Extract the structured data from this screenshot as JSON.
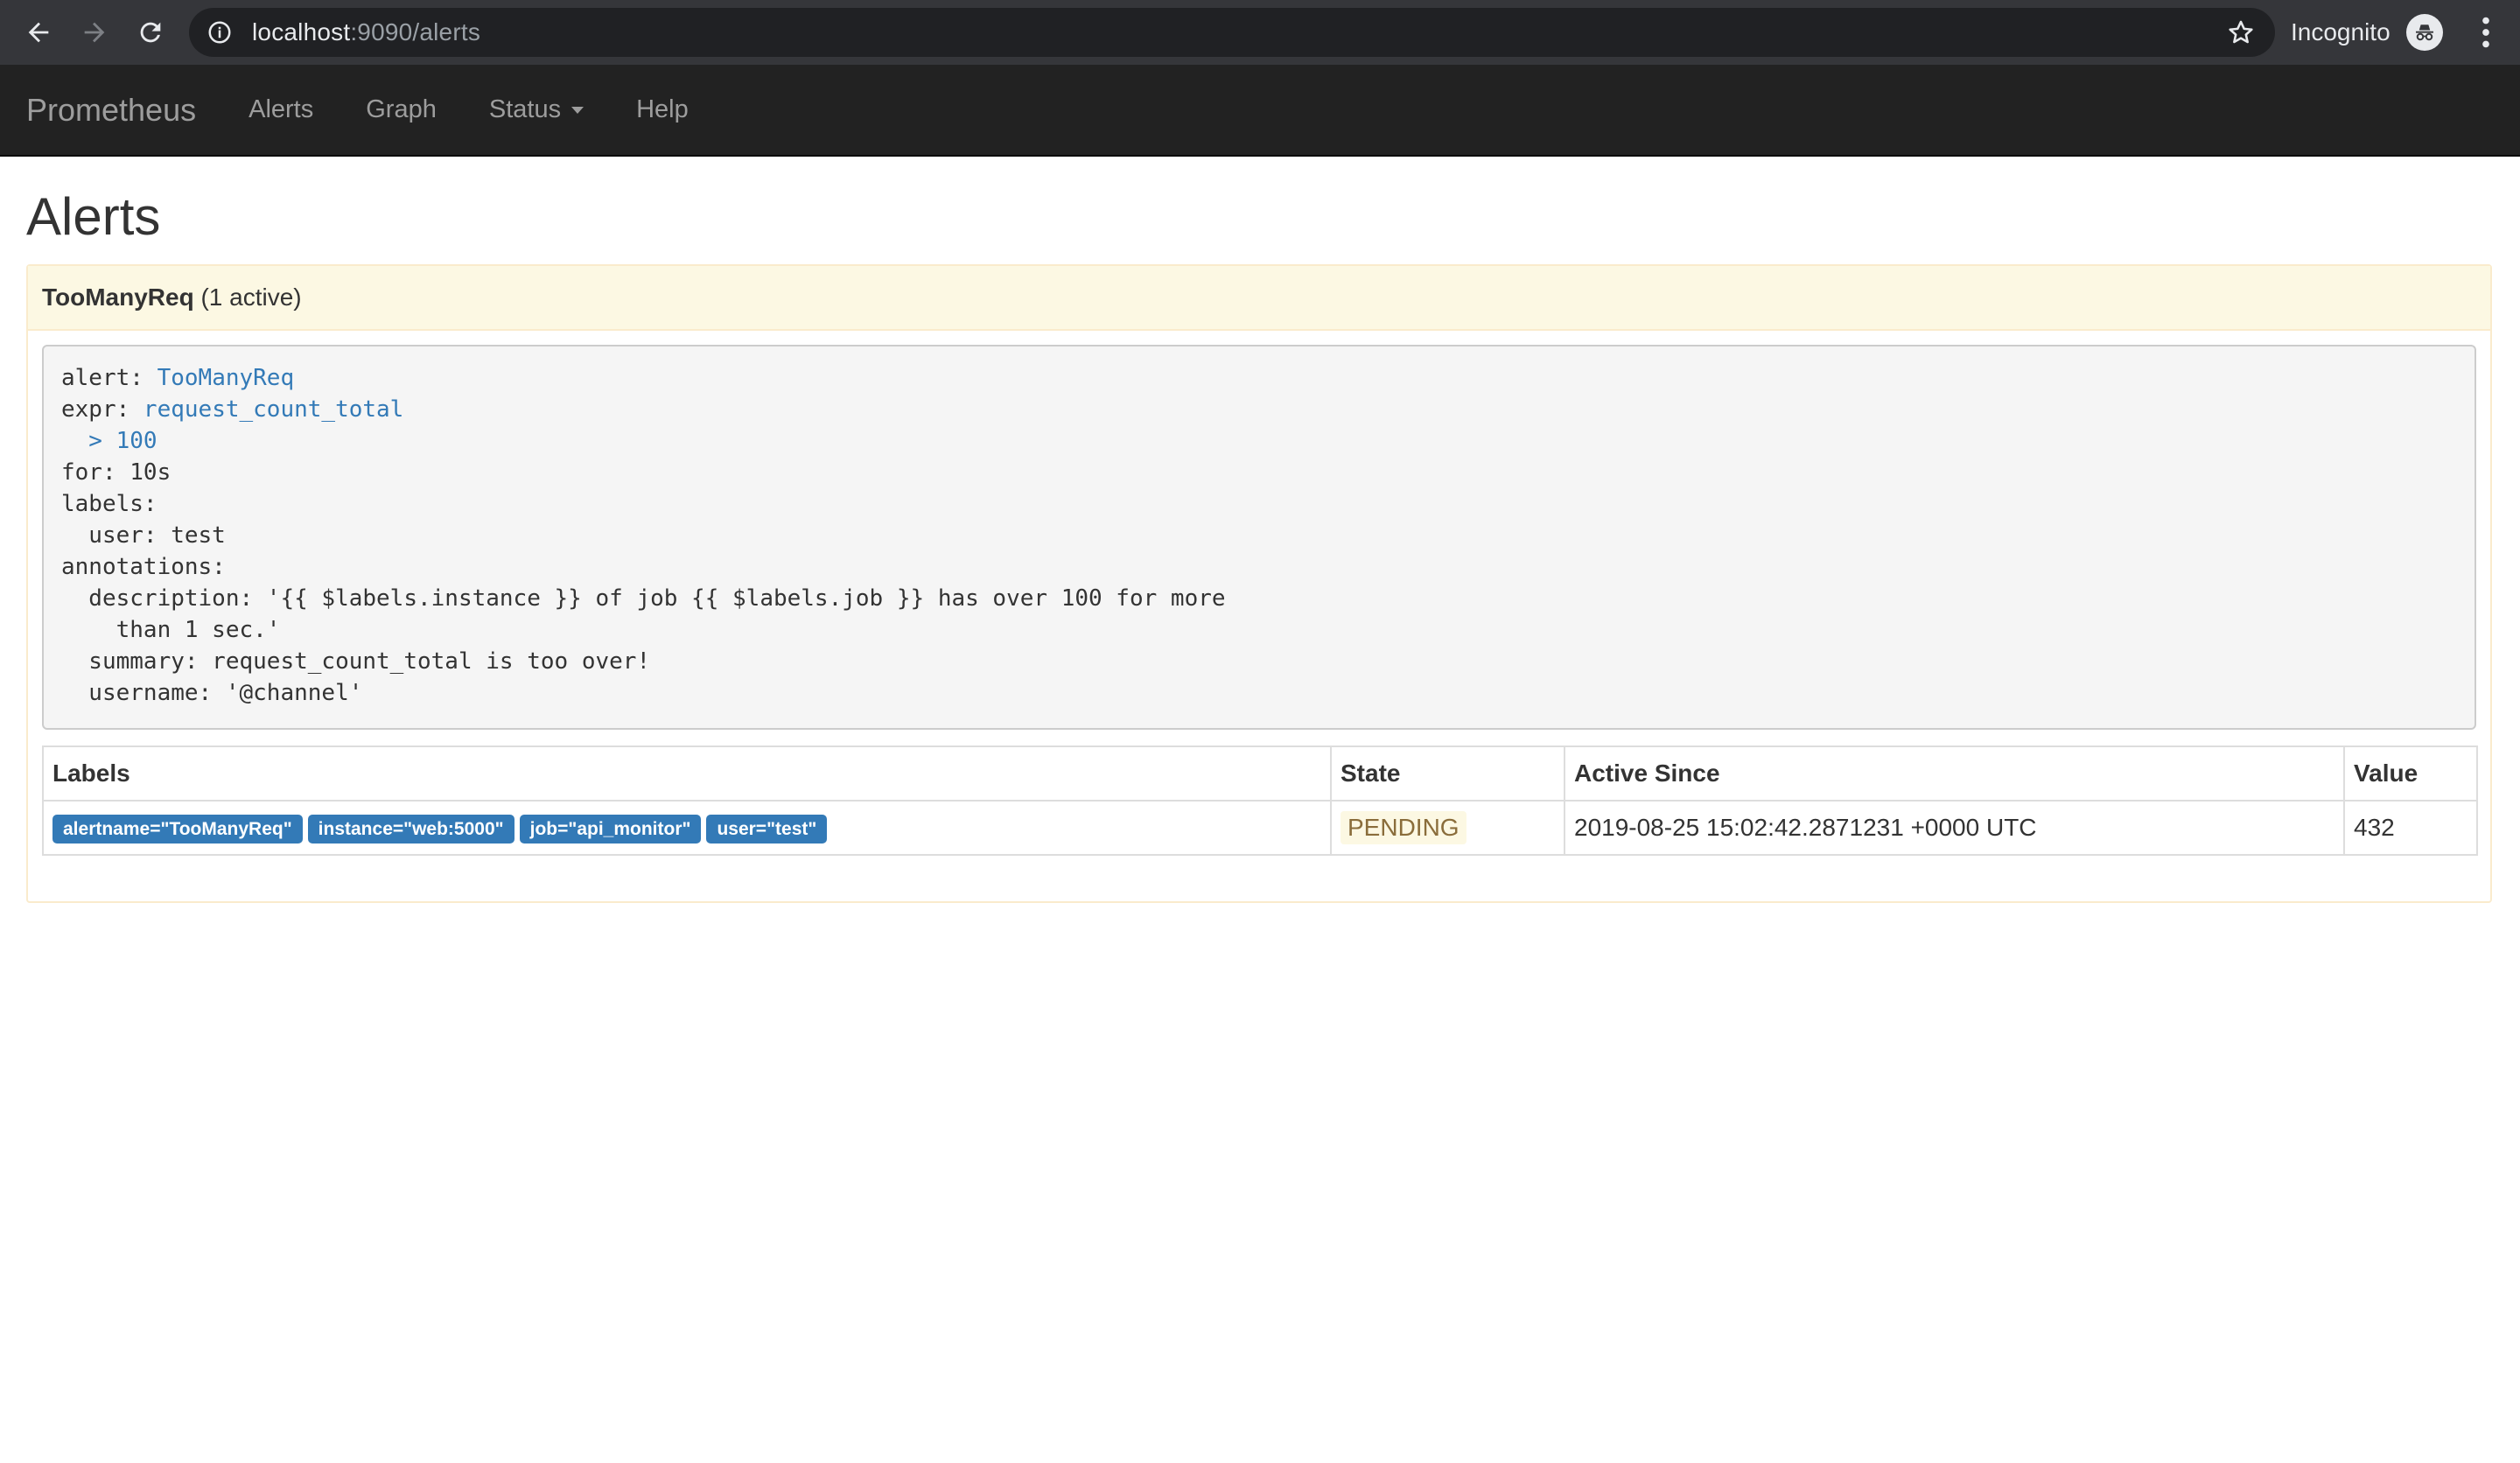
{
  "browser": {
    "url_host": "localhost",
    "url_rest": ":9090/alerts",
    "incognito_label": "Incognito"
  },
  "navbar": {
    "brand": "Prometheus",
    "links": [
      "Alerts",
      "Graph",
      "Status",
      "Help"
    ]
  },
  "page": {
    "title": "Alerts"
  },
  "alert_group": {
    "name": "TooManyReq",
    "count_text": "(1 active)",
    "rule": {
      "alert_key": "alert: ",
      "alert_value": "TooManyReq",
      "expr_key": "expr: ",
      "expr_value": "request_count_total",
      "expr_cont": "  > 100",
      "lines": [
        "for: 10s",
        "labels:",
        "  user: test",
        "annotations:",
        "  description: '{{ $labels.instance }} of job {{ $labels.job }} has over 100 for more",
        "    than 1 sec.'",
        "  summary: request_count_total is too over!",
        "  username: '@channel'"
      ]
    },
    "table": {
      "headers": [
        "Labels",
        "State",
        "Active Since",
        "Value"
      ],
      "rows": [
        {
          "labels": [
            "alertname=\"TooManyReq\"",
            "instance=\"web:5000\"",
            "job=\"api_monitor\"",
            "user=\"test\""
          ],
          "state": "PENDING",
          "active_since": "2019-08-25 15:02:42.2871231 +0000 UTC",
          "value": "432"
        }
      ]
    }
  },
  "colors": {
    "navbar_bg": "#222222",
    "panel_heading_bg": "#fcf8e3",
    "label_bg": "#337ab7",
    "pending_text": "#8a6d3b"
  }
}
